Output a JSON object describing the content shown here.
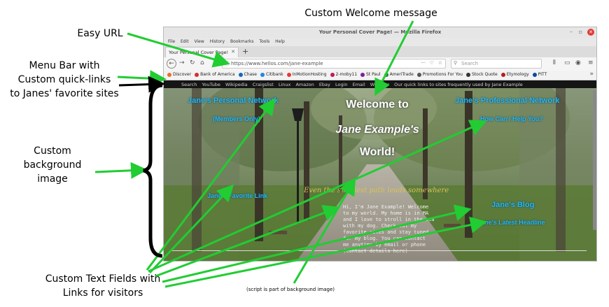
{
  "annotations": {
    "custom_welcome": "Custom Welcome message",
    "easy_url": "Easy URL",
    "menu_bar": [
      "Menu Bar with",
      "Custom quick-links",
      "to Janes' favorite sites"
    ],
    "background": [
      "Custom",
      "background",
      "image"
    ],
    "text_fields": [
      "Custom Text Fields with",
      "Links for visitors"
    ],
    "script_note": "(script is part of background image)"
  },
  "browser": {
    "title": "Your Personal Cover Page! — Mozilla Firefox",
    "menu": [
      "File",
      "Edit",
      "View",
      "History",
      "Bookmarks",
      "Tools",
      "Help"
    ],
    "tab_label": "Your Personal Cover Page!",
    "url": "https://www.hellos.com/jane-example",
    "search_placeholder": "Search",
    "bookmarks": [
      {
        "label": "Discover",
        "color": "#e8702a"
      },
      {
        "label": "Bank of America",
        "color": "#d32f2f"
      },
      {
        "label": "Chase",
        "color": "#1565c0"
      },
      {
        "label": "Citibank",
        "color": "#1e88e5"
      },
      {
        "label": "InMotionHosting",
        "color": "#e53935"
      },
      {
        "label": "2-moby11",
        "color": "#c2185b"
      },
      {
        "label": "St Paul",
        "color": "#7b1fa2"
      },
      {
        "label": "AmeriTrade",
        "color": "#2e7d32"
      },
      {
        "label": "Promotions For You",
        "color": "#555555"
      },
      {
        "label": "Stock Quote",
        "color": "#333333"
      },
      {
        "label": "Etymology",
        "color": "#b71c1c"
      },
      {
        "label": "PITT",
        "color": "#0d47a1"
      }
    ]
  },
  "site": {
    "menu_links": [
      "Search",
      "YouTube",
      "Wikipedia",
      "Craigslist",
      "Linux",
      "Amazon",
      "Ebay",
      "Login",
      "Email",
      "Weather"
    ],
    "menu_note": "Our quick links to sites frequently used by Jane Example",
    "welcome": [
      "Welcome to",
      "Jane Example's",
      "World!"
    ],
    "personal_network": "Jane's Personal Network",
    "members_only": "(Members Only)",
    "professional_network": "Jane's Professional Network",
    "how_can_i_help": "How Can I Help You?",
    "favorite_link": "Jane's Favorite Link",
    "blog": "Jane's Blog",
    "latest_headline": "Jane's Latest Headline",
    "script_text": "Even the smallest path leads somewhere",
    "body_lines": [
      "Hi, I'm Jane Example! Welcome",
      "to my world. My home is in MA",
      "and I love to stroll in the sea",
      "with my dog. Check out my",
      "favorite sites and stay tuned",
      "for my blog. You can contact",
      "me anytime by email or phone",
      "(contact details here)"
    ]
  }
}
